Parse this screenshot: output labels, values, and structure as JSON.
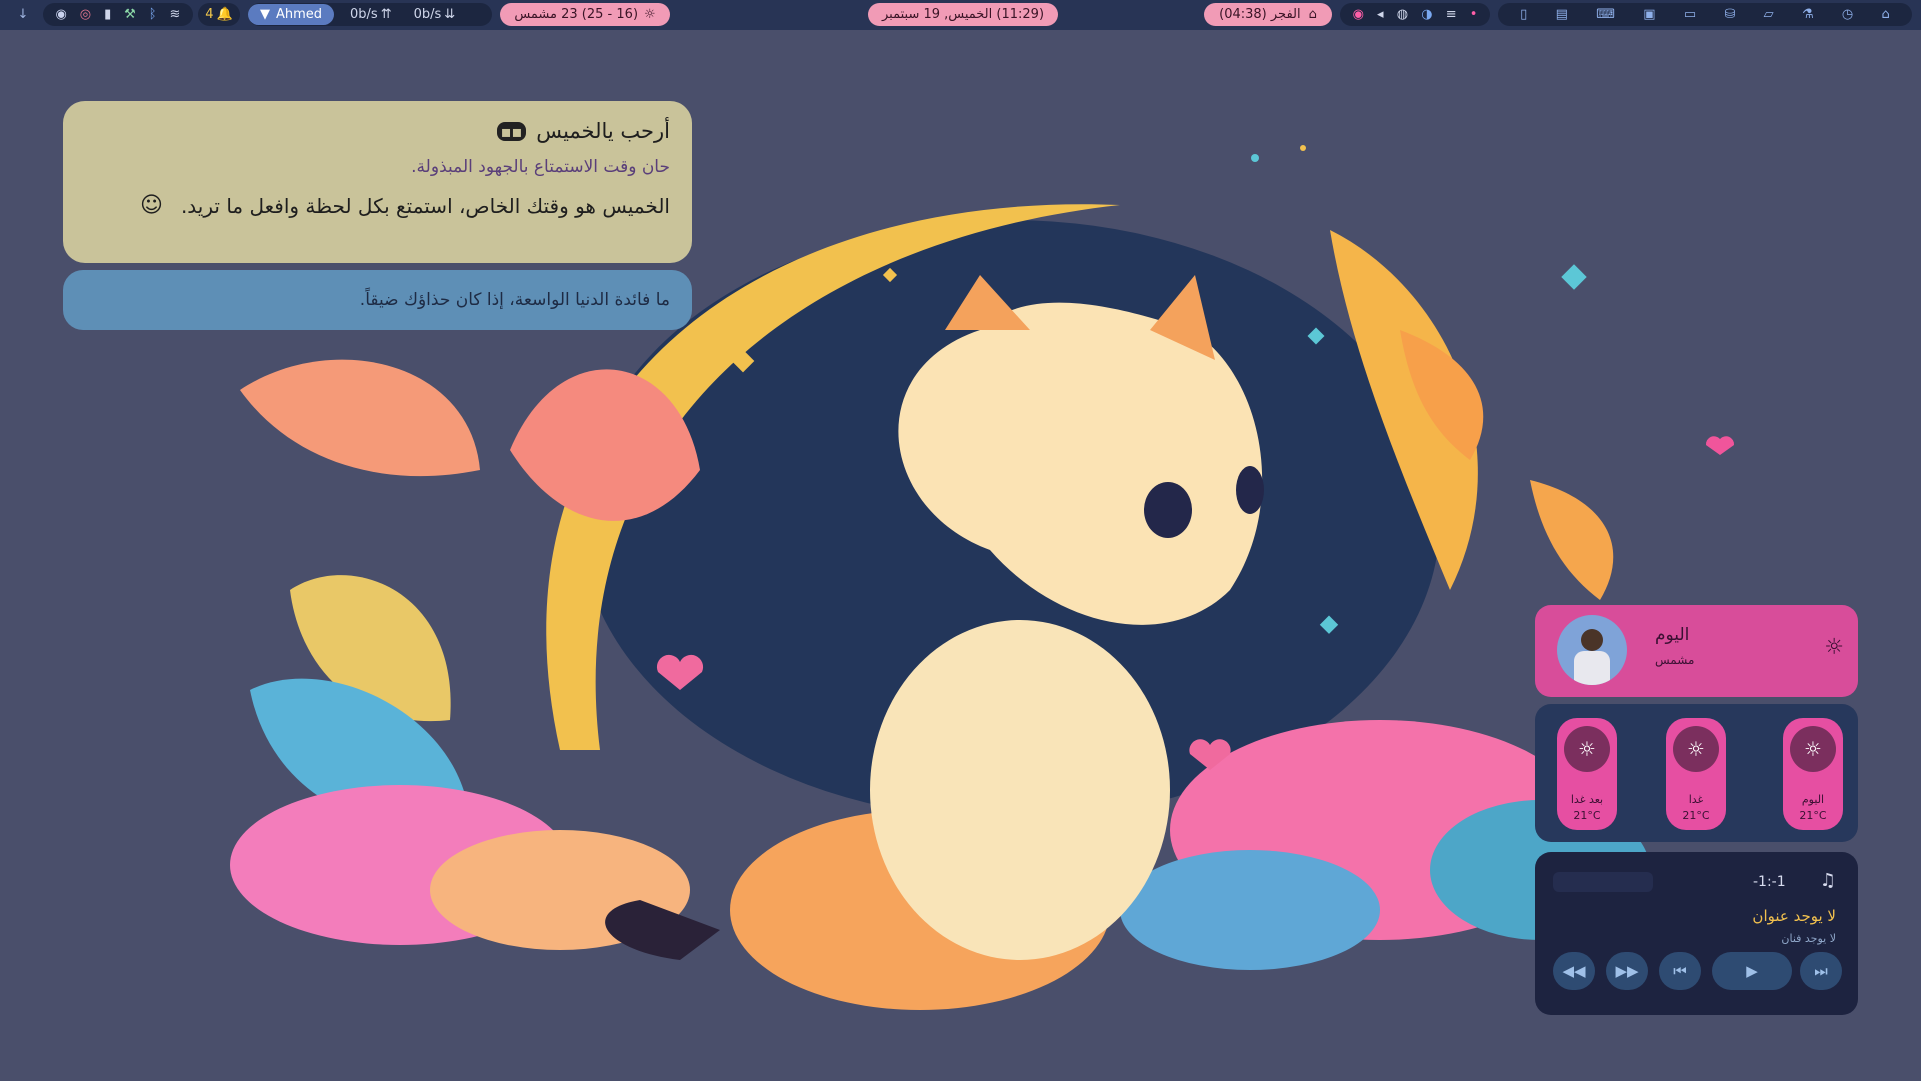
{
  "topbar": {
    "workspace_count": "4",
    "network_name": "Ahmed",
    "download_speed": "0b/s",
    "upload_speed": "0b/s",
    "weather_text": "(16 - 25) 23 مشمس",
    "datetime_text": "(11:29) الخميس, 19 سبتمبر",
    "prayer_text": "الفجر (04:38)"
  },
  "greeting": {
    "title": "أرحب يالخميس",
    "line1": "حان وقت الاستمتاع بالجهود المبذولة.",
    "line2": "الخميس هو وقتك الخاص، استمتع بكل لحظة وافعل ما تريد."
  },
  "quote": {
    "text": "ما فائدة الدنيا الواسعة، إذا كان حذاؤك ضيقاً."
  },
  "weather_widget": {
    "day_label": "اليوم",
    "condition": "مشمس"
  },
  "forecast": {
    "days": [
      {
        "label": "بعد غدا",
        "temp": "21°C"
      },
      {
        "label": "غدا",
        "temp": "21°C"
      },
      {
        "label": "اليوم",
        "temp": "21°C"
      }
    ]
  },
  "player": {
    "time": "-1:-1",
    "title": "لا يوجد عنوان",
    "artist": "لا يوجد فنان"
  },
  "colors": {
    "background": "#4a4f6b",
    "topbar": "#283455",
    "accent_pink": "#e64fa2",
    "greeting_card": "#c9c39a",
    "quote_card": "#5e8fb6"
  }
}
